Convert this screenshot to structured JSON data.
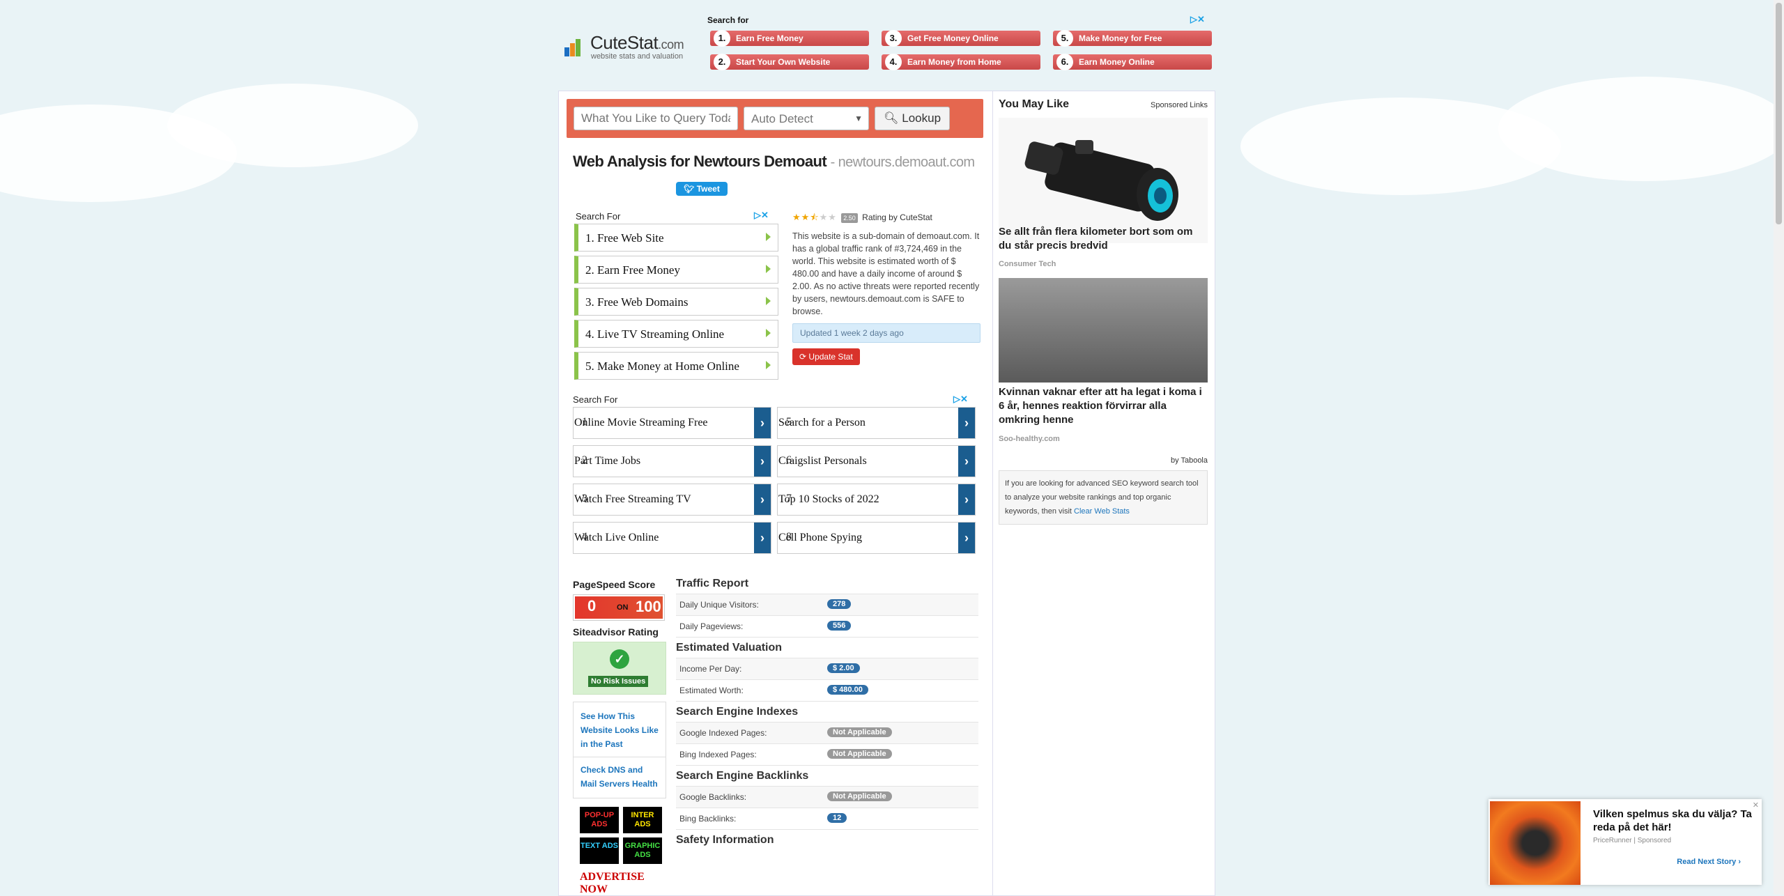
{
  "logo": {
    "name": "CuteStat",
    "domain_suffix": ".com",
    "tagline": "website stats and valuation"
  },
  "top_ads": {
    "header": "Search for",
    "items": [
      {
        "num": "1.",
        "label": "Earn Free Money"
      },
      {
        "num": "2.",
        "label": "Start Your Own Website"
      },
      {
        "num": "3.",
        "label": "Get Free Money Online"
      },
      {
        "num": "4.",
        "label": "Earn Money from Home"
      },
      {
        "num": "5.",
        "label": "Make Money for Free"
      },
      {
        "num": "6.",
        "label": "Earn Money Online"
      }
    ]
  },
  "search": {
    "placeholder": "What You Like to Query Today?",
    "select_value": "Auto Detect",
    "button_label": "Lookup"
  },
  "page": {
    "title": "Web Analysis for Newtours Demoaut",
    "subtitle": "- newtours.demoaut.com",
    "tweet_label": "Tweet"
  },
  "ads1": {
    "header": "Search For",
    "items": [
      {
        "label": "1.  Free Web Site"
      },
      {
        "label": "2.  Earn Free Money"
      },
      {
        "label": "3.  Free Web Domains"
      },
      {
        "label": "4.  Live TV Streaming Online"
      },
      {
        "label": "5.  Make Money at Home Online"
      }
    ]
  },
  "rating": {
    "score": "2.50",
    "stars_filled": 2.5,
    "stars_total": 5,
    "by_text": "Rating by CuteStat",
    "description": "This website is a sub-domain of demoaut.com. It has a global traffic rank of #3,724,469 in the world. This website is estimated worth of $ 480.00 and have a daily income of around $ 2.00. As no active threats were reported recently by users, newtours.demoaut.com is SAFE to browse.",
    "updated": "Updated 1 week 2 days ago",
    "update_button": "Update Stat"
  },
  "ads2": {
    "header": "Search For",
    "items": [
      {
        "num": "1",
        "label": "Online Movie Streaming Free"
      },
      {
        "num": "5",
        "label": "Search for a Person"
      },
      {
        "num": "2",
        "label": "Part Time Jobs"
      },
      {
        "num": "6",
        "label": "Craigslist Personals"
      },
      {
        "num": "3",
        "label": "Watch Free Streaming TV"
      },
      {
        "num": "7",
        "label": "Top 10 Stocks of 2022"
      },
      {
        "num": "4",
        "label": "Watch Live Online"
      },
      {
        "num": "8",
        "label": "Cell Phone Spying"
      }
    ]
  },
  "left_col": {
    "pagespeed_title": "PageSpeed Score",
    "pagespeed_score": "0",
    "pagespeed_on": "ON",
    "pagespeed_max": "100",
    "siteadvisor_title": "Siteadvisor Rating",
    "siteadvisor_status": "No Risk Issues",
    "link1": "See How This Website Looks Like in the Past",
    "link2": "Check DNS and Mail Servers Health",
    "ad_tiles": [
      "POP-UP ADS",
      "INTER ADS",
      "TEXT ADS",
      "GRAPHIC ADS"
    ],
    "advertise_now": "ADVERTISE NOW"
  },
  "stats": {
    "traffic_title": "Traffic Report",
    "daily_visitors_label": "Daily Unique Visitors:",
    "daily_visitors": "278",
    "daily_pageviews_label": "Daily Pageviews:",
    "daily_pageviews": "556",
    "valuation_title": "Estimated Valuation",
    "income_label": "Income Per Day:",
    "income": "$ 2.00",
    "worth_label": "Estimated Worth:",
    "worth": "$ 480.00",
    "indexes_title": "Search Engine Indexes",
    "google_indexed_label": "Google Indexed Pages:",
    "google_indexed": "Not Applicable",
    "bing_indexed_label": "Bing Indexed Pages:",
    "bing_indexed": "Not Applicable",
    "backlinks_title": "Search Engine Backlinks",
    "google_backlinks_label": "Google Backlinks:",
    "google_backlinks": "Not Applicable",
    "bing_backlinks_label": "Bing Backlinks:",
    "bing_backlinks": "12",
    "safety_title": "Safety Information"
  },
  "sidebar": {
    "title": "You May Like",
    "sponsored": "Sponsored Links",
    "item1_title": "Se allt från flera kilometer bort som om du står precis bredvid",
    "item1_source": "Consumer Tech",
    "item2_title": "Kvinnan vaknar efter att ha legat i koma i 6 år, hennes reaktion förvirrar alla omkring henne",
    "item2_source": "Soo-healthy.com",
    "by_taboola": "by Taboola",
    "seo_text": "If you are looking for advanced SEO keyword search tool to analyze your website rankings and top organic keywords, then visit",
    "seo_link": "Clear Web Stats"
  },
  "popup": {
    "title": "Vilken spelmus ska du välja? Ta reda på det här!",
    "source": "PriceRunner | Sponsored",
    "read_next": "Read Next Story ›"
  },
  "colors": {
    "accent_red": "#e5674f",
    "link_blue": "#1c75bc",
    "badge_blue": "#2f6ea6",
    "ad_green": "#8bc34a",
    "ad_dark_blue": "#1b5d8f"
  }
}
